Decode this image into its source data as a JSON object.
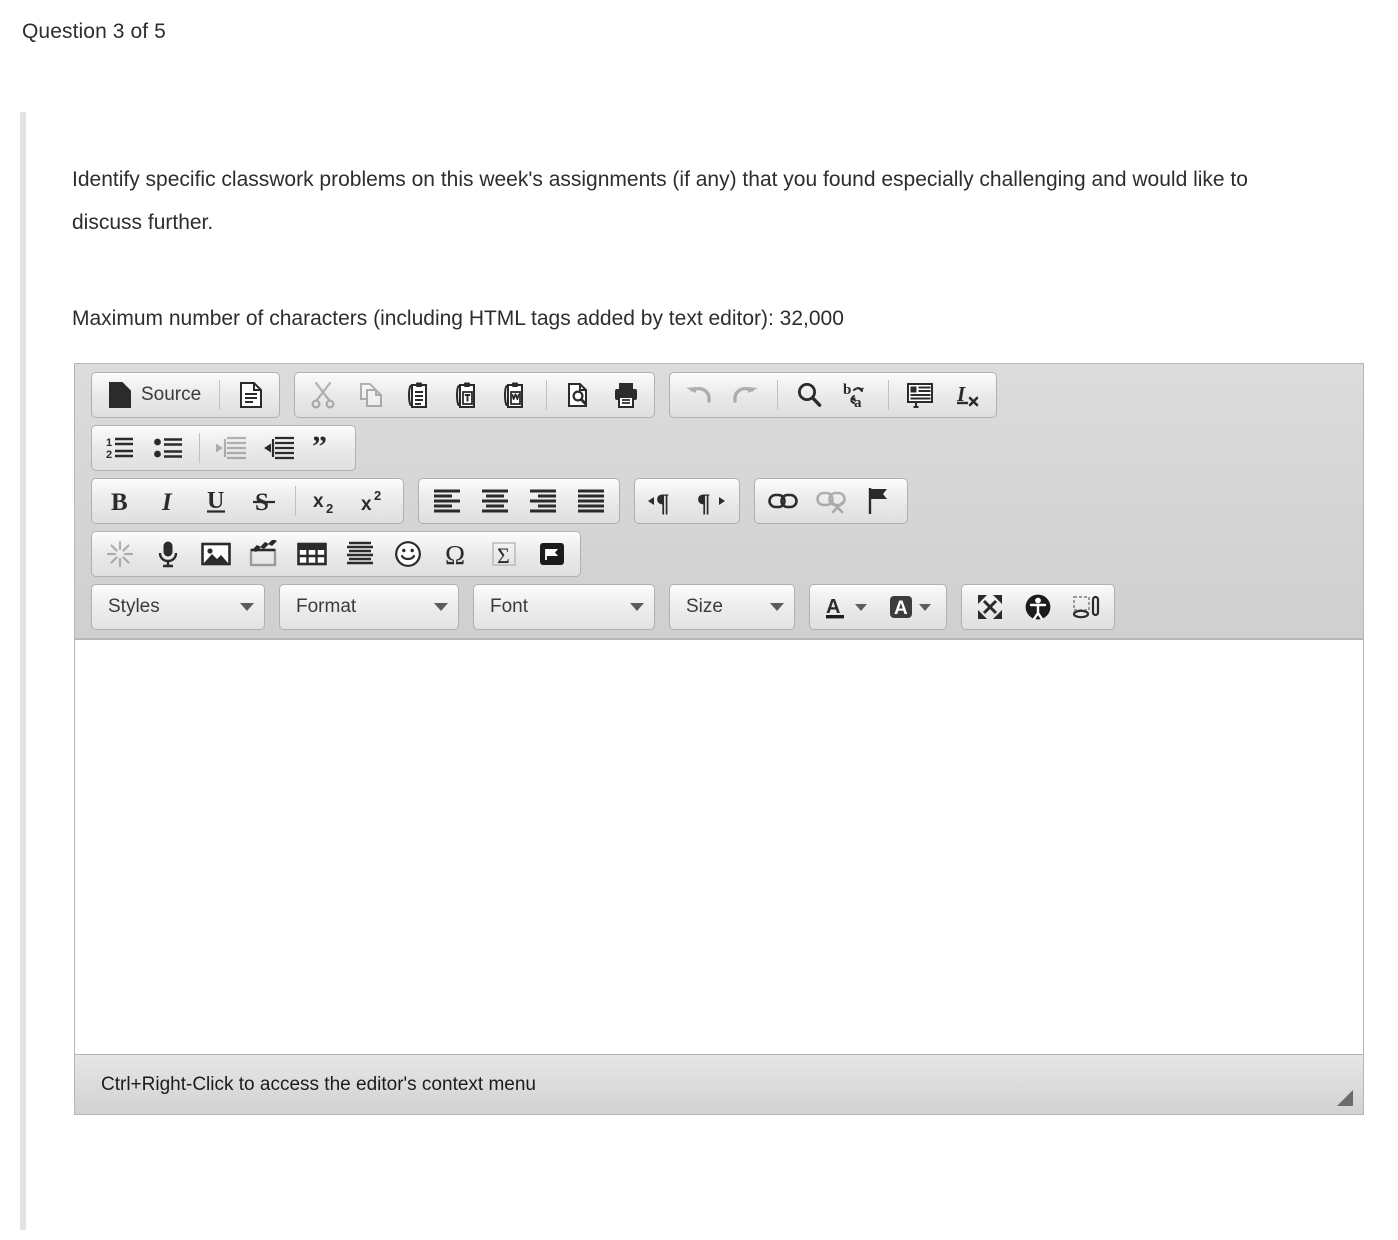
{
  "header": {
    "question_counter": "Question 3 of 5"
  },
  "question": {
    "prompt": "Identify specific classwork problems on this week's assignments (if any) that you found especially challenging and would like to discuss further.",
    "max_chars_note": "Maximum number of characters (including HTML tags added by text editor): 32,000"
  },
  "editor": {
    "source_label": "Source",
    "status_text": "Ctrl+Right-Click to access the editor's context menu",
    "content": "",
    "dropdowns": {
      "styles": "Styles",
      "format": "Format",
      "font": "Font",
      "size": "Size"
    },
    "toolbar_rows": [
      {
        "groups": [
          {
            "buttons": [
              "source-button",
              "new-page-icon"
            ]
          },
          {
            "buttons": [
              "cut-icon",
              "copy-icon",
              "paste-icon",
              "paste-as-plain-text-icon",
              "paste-from-word-icon",
              "preview-icon",
              "print-icon"
            ]
          },
          {
            "buttons": [
              "undo-icon",
              "redo-icon",
              "find-icon",
              "replace-icon",
              "select-all-icon",
              "remove-format-icon"
            ]
          }
        ]
      },
      {
        "groups": [
          {
            "buttons": [
              "numbered-list-icon",
              "bulleted-list-icon",
              "decrease-indent-icon",
              "increase-indent-icon",
              "blockquote-icon"
            ]
          }
        ]
      },
      {
        "groups": [
          {
            "buttons": [
              "bold-icon",
              "italic-icon",
              "underline-icon",
              "strikethrough-icon",
              "subscript-icon",
              "superscript-icon"
            ]
          },
          {
            "buttons": [
              "align-left-icon",
              "align-center-icon",
              "align-right-icon",
              "justify-icon"
            ]
          },
          {
            "buttons": [
              "text-direction-ltr-icon",
              "text-direction-rtl-icon"
            ]
          },
          {
            "buttons": [
              "link-icon",
              "unlink-icon",
              "anchor-icon"
            ]
          }
        ]
      },
      {
        "groups": [
          {
            "buttons": [
              "flash-icon",
              "audio-recorder-icon",
              "image-icon",
              "video-icon",
              "table-icon",
              "horizontal-rule-icon",
              "smiley-icon",
              "special-character-icon",
              "math-formula-icon",
              "page-break-icon"
            ]
          }
        ]
      },
      {
        "groups": [
          {
            "buttons": [
              "styles-dropdown",
              "format-dropdown",
              "font-dropdown",
              "size-dropdown"
            ]
          },
          {
            "buttons": [
              "text-color-icon",
              "background-color-icon"
            ]
          },
          {
            "buttons": [
              "maximize-icon",
              "accessibility-checker-icon",
              "templates-icon"
            ]
          }
        ]
      }
    ],
    "disabled_buttons": [
      "cut-icon",
      "copy-icon",
      "undo-icon",
      "redo-icon",
      "decrease-indent-icon",
      "unlink-icon",
      "flash-icon"
    ]
  },
  "colors": {
    "page_background": "#ffffff",
    "text": "#2d2d2d",
    "accent_strip": "#e3e3e3",
    "toolbar_background": "#d4d4d4",
    "frame_border": "#b6b6b6",
    "resize_handle": "#6b6b6b"
  }
}
